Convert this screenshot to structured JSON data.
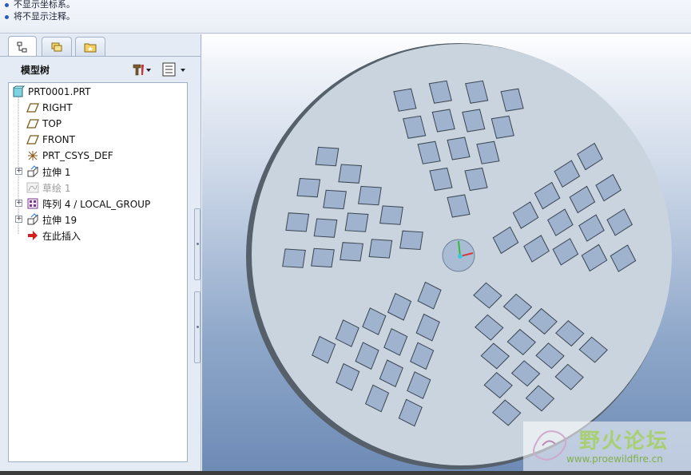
{
  "messages": [
    {
      "text": "不显示坐标系。"
    },
    {
      "text": "将不显示注释。"
    }
  ],
  "navigator": {
    "tabs": [
      {
        "name": "model-tree-tab",
        "icon": "model-tree-icon",
        "active": true
      },
      {
        "name": "folder-browser-tab",
        "icon": "layers-icon",
        "active": false
      },
      {
        "name": "favorites-tab",
        "icon": "favorites-folder-icon",
        "active": false
      }
    ],
    "title": "模型树",
    "tools": [
      {
        "name": "settings-tools",
        "icon": "hammer-icon"
      },
      {
        "name": "show-options",
        "icon": "list-icon"
      }
    ]
  },
  "tree": {
    "items": [
      {
        "label": "PRT0001.PRT",
        "icon": "part-icon",
        "level": 0,
        "expandable": false,
        "dim": false
      },
      {
        "label": "RIGHT",
        "icon": "datum-plane-icon",
        "level": 1,
        "expandable": false,
        "dim": false
      },
      {
        "label": "TOP",
        "icon": "datum-plane-icon",
        "level": 1,
        "expandable": false,
        "dim": false
      },
      {
        "label": "FRONT",
        "icon": "datum-plane-icon",
        "level": 1,
        "expandable": false,
        "dim": false
      },
      {
        "label": "PRT_CSYS_DEF",
        "icon": "csys-icon",
        "level": 1,
        "expandable": false,
        "dim": false
      },
      {
        "label": "拉伸 1",
        "icon": "extrude-icon",
        "level": 1,
        "expandable": true,
        "dim": false
      },
      {
        "label": "草绘 1",
        "icon": "sketch-icon",
        "level": 1,
        "expandable": false,
        "dim": true
      },
      {
        "label": "阵列 4 / LOCAL_GROUP",
        "icon": "pattern-icon",
        "level": 1,
        "expandable": true,
        "dim": false
      },
      {
        "label": "拉伸 19",
        "icon": "extrude-icon",
        "level": 1,
        "expandable": true,
        "dim": false
      },
      {
        "label": "在此插入",
        "icon": "insert-arrow-icon",
        "level": 1,
        "expandable": false,
        "dim": false
      }
    ]
  },
  "watermark": {
    "title": "野火论坛",
    "url": "www.proewildfire.cn"
  },
  "colors": {
    "disk": "#c9d4de",
    "hole": "#9fb3cf",
    "accent": "#2b5bb8"
  }
}
